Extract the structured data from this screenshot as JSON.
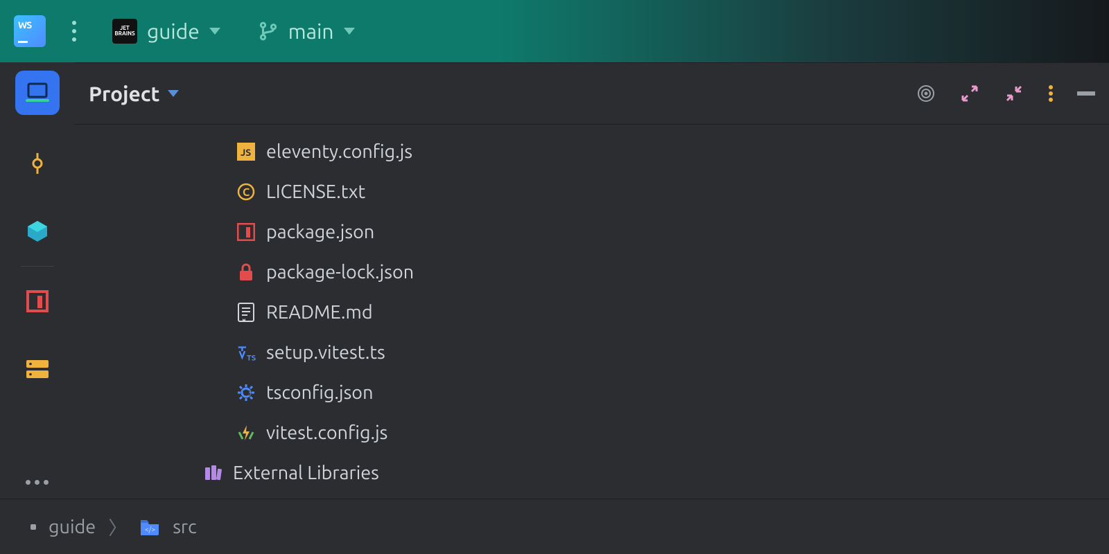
{
  "titlebar": {
    "project_label": "guide",
    "branch_label": "main"
  },
  "panel": {
    "title": "Project"
  },
  "tree": {
    "items": [
      {
        "icon": "js",
        "name": "eleventy.config.js"
      },
      {
        "icon": "copyright",
        "name": "LICENSE.txt"
      },
      {
        "icon": "npm",
        "name": "package.json"
      },
      {
        "icon": "lock",
        "name": "package-lock.json"
      },
      {
        "icon": "readme",
        "name": "README.md"
      },
      {
        "icon": "vitest-ts",
        "name": "setup.vitest.ts"
      },
      {
        "icon": "ts-gear",
        "name": "tsconfig.json"
      },
      {
        "icon": "vitest",
        "name": "vitest.config.js"
      }
    ],
    "external_label": "External Libraries"
  },
  "breadcrumbs": {
    "root": "guide",
    "folder": "src"
  }
}
